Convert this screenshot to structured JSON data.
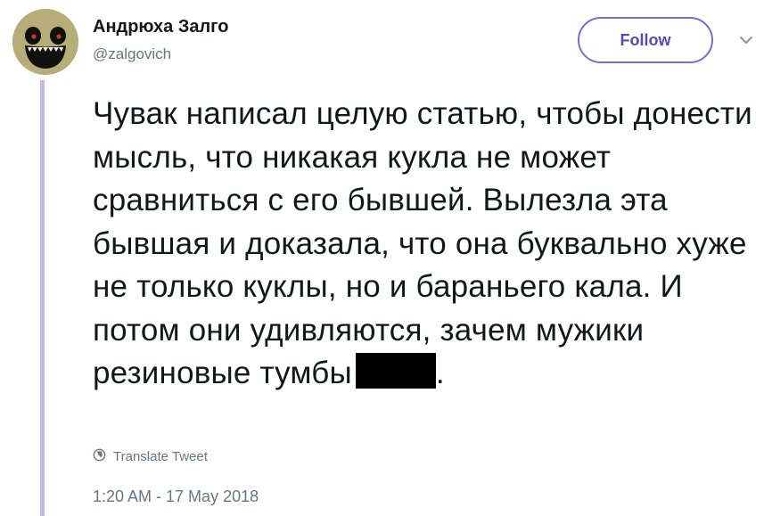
{
  "user": {
    "display_name": "Андрюха Залго",
    "handle": "@zalgovich",
    "avatar_icon": "grinning-face-avatar-icon"
  },
  "actions": {
    "follow_label": "Follow",
    "more_icon": "chevron-down-icon"
  },
  "tweet": {
    "text": "Чувак написал целую статью, чтобы донести мысль, что никакая кукла не может сравниться с его бывшей. Вылезла эта бывшая и доказала, что она буквально хуже не только куклы, но и бараньего кала. И потом они удивляются, зачем мужики резиновые тумбы",
    "redacted": true,
    "trailing": "."
  },
  "translate": {
    "label": "Translate Tweet",
    "icon": "globe-icon"
  },
  "timestamp": "1:20 AM - 17 May 2018",
  "colors": {
    "accent": "#7d6ad1",
    "thread_line": "#c7b8e8",
    "muted": "#657786",
    "text": "#14171a"
  }
}
